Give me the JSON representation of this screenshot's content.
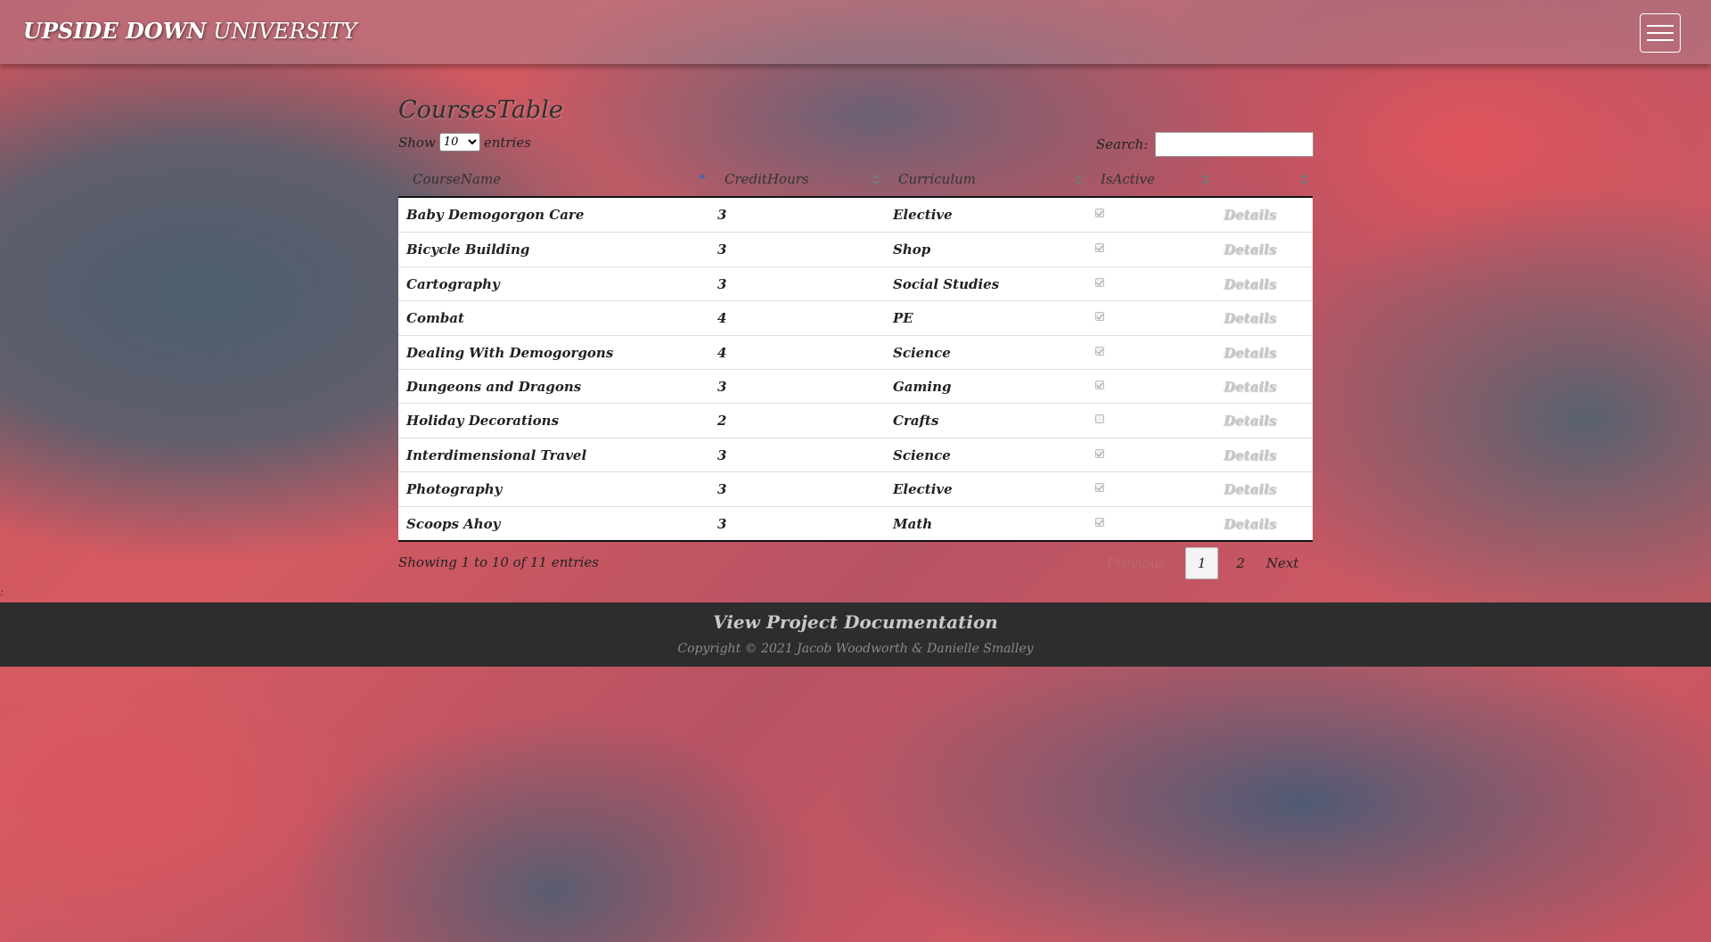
{
  "header": {
    "brand_bold": "UPSIDE DOWN",
    "brand_thin": "UNIVERSITY",
    "menu_icon": "hamburger-icon"
  },
  "page": {
    "title": "CoursesTable"
  },
  "controls": {
    "show_label": "Show",
    "entries_label": "entries",
    "length_value": "10",
    "search_label": "Search:",
    "search_value": ""
  },
  "table": {
    "columns": [
      "CourseName",
      "CreditHours",
      "Curriculum",
      "IsActive",
      ""
    ],
    "sorted_column": "CourseName",
    "rows": [
      {
        "name": "Baby Demogorgon Care",
        "hours": "3",
        "curriculum": "Elective",
        "active": true,
        "details": "Details"
      },
      {
        "name": "Bicycle Building",
        "hours": "3",
        "curriculum": "Shop",
        "active": true,
        "details": "Details"
      },
      {
        "name": "Cartography",
        "hours": "3",
        "curriculum": "Social Studies",
        "active": true,
        "details": "Details"
      },
      {
        "name": "Combat",
        "hours": "4",
        "curriculum": "PE",
        "active": true,
        "details": "Details"
      },
      {
        "name": "Dealing With Demogorgons",
        "hours": "4",
        "curriculum": "Science",
        "active": true,
        "details": "Details"
      },
      {
        "name": "Dungeons and Dragons",
        "hours": "3",
        "curriculum": "Gaming",
        "active": true,
        "details": "Details"
      },
      {
        "name": "Holiday Decorations",
        "hours": "2",
        "curriculum": "Crafts",
        "active": false,
        "details": "Details"
      },
      {
        "name": "Interdimensional Travel",
        "hours": "3",
        "curriculum": "Science",
        "active": true,
        "details": "Details"
      },
      {
        "name": "Photography",
        "hours": "3",
        "curriculum": "Elective",
        "active": true,
        "details": "Details"
      },
      {
        "name": "Scoops Ahoy",
        "hours": "3",
        "curriculum": "Math",
        "active": true,
        "details": "Details"
      }
    ]
  },
  "pagination": {
    "info": "Showing 1 to 10 of 11 entries",
    "previous": "Previous",
    "pages": [
      "1",
      "2"
    ],
    "current": "1",
    "next": "Next"
  },
  "footer": {
    "link": "View Project Documentation",
    "copyright": "Copyright © 2021 Jacob Woodworth & Danielle Smalley"
  },
  "stray_text": ":"
}
